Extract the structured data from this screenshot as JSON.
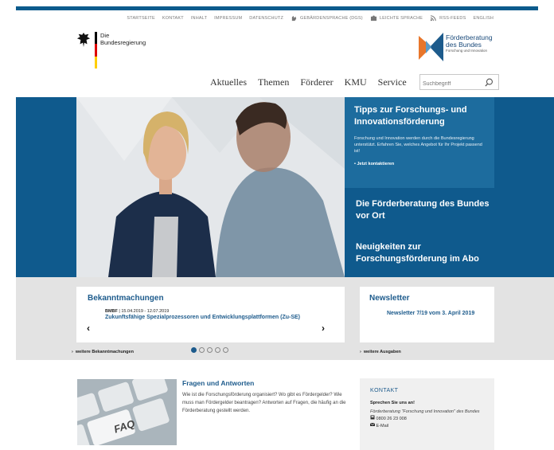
{
  "meta_nav": [
    "STARTSEITE",
    "KONTAKT",
    "INHALT",
    "IMPRESSUM",
    "DATENSCHUTZ",
    "GEBÄRDENSPRACHE (DGS)",
    "LEICHTE SPRACHE",
    "RSS-FEEDS",
    "ENGLISH"
  ],
  "gov_logo": {
    "line1": "Die",
    "line2": "Bundesregierung"
  },
  "fb_logo": {
    "line1": "Förderberatung",
    "line2": "des Bundes",
    "line3": "Forschung und Innovation"
  },
  "main_nav": [
    "Aktuelles",
    "Themen",
    "Förderer",
    "KMU",
    "Service"
  ],
  "search": {
    "placeholder": "Suchbegriff"
  },
  "hero": {
    "tips_title": "Tipps zur Forschungs- und Innovationsförderung",
    "tips_text": "Forschung und Innovation werden durch die Bundesregierung unterstützt. Erfahren Sie, welches Angebot für Ihr Projekt passend ist!",
    "tips_link": "• Jetzt kontaktieren",
    "link1": "Die Förderberatung des Bundes vor Ort",
    "link2": "Neuigkeiten zur Forschungsförderung im Abo"
  },
  "bekanntmachungen": {
    "heading": "Bekanntmachungen",
    "meta_org": "BMBF",
    "meta_dates": " | 15.04.2019 - 12.07.2019",
    "title": "Zukunftsfähige Spezialprozessoren und Entwicklungsplattformen (Zu-SE)",
    "more": "weitere Bekanntmachungen",
    "prev": "‹",
    "next": "›"
  },
  "newsletter": {
    "heading": "Newsletter",
    "item": "Newsletter 7/19 vom 3. April 2019",
    "more": "weitere Ausgaben"
  },
  "faq": {
    "img_text": "FAQ",
    "heading": "Fragen und Antworten",
    "text": "Wie ist die Forschungsförderung organisiert? Wo gibt es Fördergelder? Wie muss man Fördergelder beantragen? Antworten auf Fragen, die häufig an die Förderberatung gestellt werden."
  },
  "kontakt": {
    "heading": "KONTAKT",
    "subheading": "Sprechen Sie uns an!",
    "org": "Förderberatung \"Forschung und Innovation\" des Bundes",
    "phone": "0800 26 23 008",
    "email": "E-Mail"
  },
  "colors": {
    "brand_blue": "#0f5a8d",
    "link_blue": "#1d5b8c",
    "flag_black": "#000000",
    "flag_red": "#dd0000",
    "flag_gold": "#ffce00",
    "fb_orange": "#e8762b"
  }
}
